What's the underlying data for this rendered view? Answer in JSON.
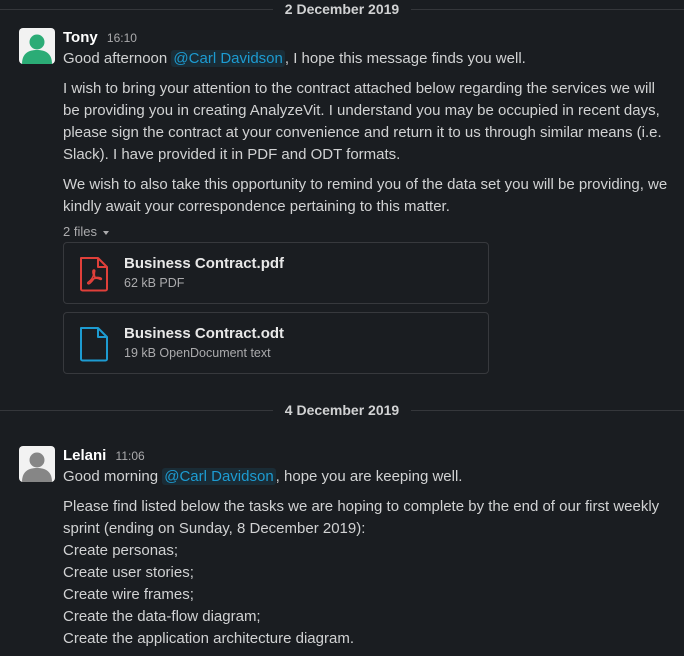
{
  "dividers": {
    "first": "2 December 2019",
    "second": "4 December 2019"
  },
  "messages": [
    {
      "author": "Tony",
      "time": "16:10",
      "greeting_before": "Good afternoon ",
      "mention": "@Carl Davidson",
      "greeting_after": ", I hope this message finds you well.",
      "paragraph1": "I wish to bring your attention to the contract attached below regarding the services we will be providing you in creating AnalyzeVit. I understand you may be occupied in recent days, please sign the contract at your convenience and return it to us through similar means (i.e. Slack). I have provided it in PDF and ODT formats.",
      "paragraph2": "We wish to also take this opportunity to remind you of the data set you will be providing, we kindly await your correspondence pertaining to this matter.",
      "files_label": "2 files",
      "files": [
        {
          "name": "Business Contract.pdf",
          "meta": "62 kB PDF",
          "icon": "pdf-file-icon",
          "color": "#e0403a"
        },
        {
          "name": "Business Contract.odt",
          "meta": "19 kB OpenDocument text",
          "icon": "document-file-icon",
          "color": "#1d9bd1"
        }
      ]
    },
    {
      "author": "Lelani",
      "time": "11:06",
      "greeting_before": "Good morning ",
      "mention": "@Carl Davidson",
      "greeting_after": ", hope you are keeping well.",
      "paragraph1": "Please find listed below the tasks we are hoping to complete by the end of our first weekly sprint (ending on Sunday, 8 December 2019):",
      "tasks": [
        "Create personas;",
        "Create user stories;",
        "Create wire frames;",
        "Create the data-flow diagram;",
        "Create the application architecture diagram."
      ]
    }
  ],
  "colors": {
    "background": "#1a1d21",
    "mention": "#1d9bd1",
    "tony_avatar": "#2bac76",
    "lelani_avatar": "#868686"
  }
}
